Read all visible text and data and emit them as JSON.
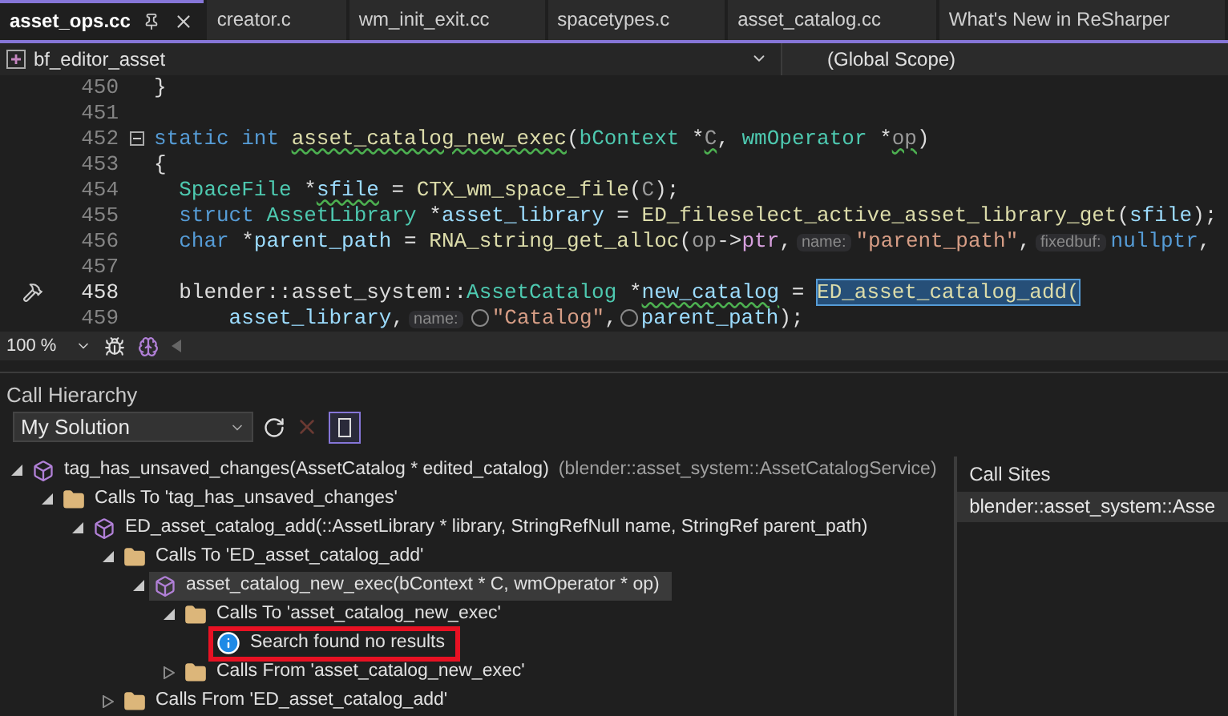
{
  "tabs": [
    {
      "label": "asset_ops.cc",
      "selected": true
    },
    {
      "label": "creator.c",
      "selected": false
    },
    {
      "label": "wm_init_exit.cc",
      "selected": false
    },
    {
      "label": "spacetypes.c",
      "selected": false
    },
    {
      "label": "asset_catalog.cc",
      "selected": false
    },
    {
      "label": "What's New in ReSharper",
      "selected": false
    }
  ],
  "navigation": {
    "project": "bf_editor_asset",
    "scope": "(Global Scope)"
  },
  "code_lines": [
    {
      "number": "450",
      "current": false,
      "collapsible": false,
      "marker": false,
      "tokens": [
        {
          "text": "}",
          "kind": "plain",
          "squiggle": false,
          "selected": false
        }
      ]
    },
    {
      "number": "451",
      "current": false,
      "collapsible": false,
      "marker": false
    },
    {
      "number": "452",
      "current": false,
      "collapsible": true,
      "marker": false,
      "tokens": [
        {
          "text": "static",
          "kind": "kw",
          "squiggle": false,
          "selected": false
        },
        {
          "text": " int ",
          "kind": "kw",
          "squiggle": false,
          "selected": false
        },
        {
          "text": "asset_catalog_new_exec",
          "kind": "fn",
          "squiggle": true,
          "selected": false
        },
        {
          "text": "(",
          "kind": "plain",
          "squiggle": false,
          "selected": false
        },
        {
          "text": "bContext",
          "kind": "type",
          "squiggle": false,
          "selected": false
        },
        {
          "text": " *",
          "kind": "plain",
          "squiggle": false,
          "selected": false
        },
        {
          "text": "C",
          "kind": "param",
          "squiggle": true,
          "selected": false
        },
        {
          "text": ",",
          "kind": "plain",
          "squiggle": false,
          "selected": false
        },
        {
          "text": " wmOperator",
          "kind": "type",
          "squiggle": false,
          "selected": false
        },
        {
          "text": " *",
          "kind": "plain",
          "squiggle": false,
          "selected": false
        },
        {
          "text": "op",
          "kind": "param",
          "squiggle": true,
          "selected": false
        },
        {
          "text": ")",
          "kind": "plain",
          "squiggle": false,
          "selected": false
        }
      ]
    },
    {
      "number": "453",
      "current": false,
      "collapsible": false,
      "marker": false,
      "tokens": [
        {
          "text": "{",
          "kind": "plain",
          "squiggle": false,
          "selected": false
        }
      ]
    },
    {
      "number": "454",
      "current": false,
      "collapsible": false,
      "marker": false,
      "tokens": [
        {
          "text": "  SpaceFile",
          "kind": "type",
          "squiggle": false,
          "selected": false
        },
        {
          "text": " *",
          "kind": "plain",
          "squiggle": false,
          "selected": false
        },
        {
          "text": "sfile",
          "kind": "var",
          "squiggle": true,
          "selected": false
        },
        {
          "text": " = ",
          "kind": "plain",
          "squiggle": false,
          "selected": false
        },
        {
          "text": "CTX_wm_space_file",
          "kind": "fn",
          "squiggle": false,
          "selected": false
        },
        {
          "text": "(",
          "kind": "plain",
          "squiggle": false,
          "selected": false
        },
        {
          "text": "C",
          "kind": "param",
          "squiggle": false,
          "selected": false
        },
        {
          "text": ");",
          "kind": "plain",
          "squiggle": false,
          "selected": false
        }
      ]
    },
    {
      "number": "455",
      "current": false,
      "collapsible": false,
      "marker": false,
      "tokens": [
        {
          "text": "  struct",
          "kind": "kw",
          "squiggle": false,
          "selected": false
        },
        {
          "text": " AssetLibrary",
          "kind": "type",
          "squiggle": false,
          "selected": false
        },
        {
          "text": " *",
          "kind": "plain",
          "squiggle": false,
          "selected": false
        },
        {
          "text": "asset_library",
          "kind": "var",
          "squiggle": false,
          "selected": false
        },
        {
          "text": " = ",
          "kind": "plain",
          "squiggle": false,
          "selected": false
        },
        {
          "text": "ED_fileselect_active_asset_library_get",
          "kind": "fn",
          "squiggle": false,
          "selected": false
        },
        {
          "text": "(",
          "kind": "plain",
          "squiggle": false,
          "selected": false
        },
        {
          "text": "sfile",
          "kind": "var",
          "squiggle": false,
          "selected": false
        },
        {
          "text": ");",
          "kind": "plain",
          "squiggle": false,
          "selected": false
        }
      ]
    },
    {
      "number": "456",
      "current": false,
      "collapsible": false,
      "marker": false,
      "tokens": [
        {
          "text": "  char",
          "kind": "kw",
          "squiggle": false,
          "selected": false
        },
        {
          "text": " *",
          "kind": "plain",
          "squiggle": false,
          "selected": false
        },
        {
          "text": "parent_path",
          "kind": "var",
          "squiggle": false,
          "selected": false
        },
        {
          "text": " = ",
          "kind": "plain",
          "squiggle": false,
          "selected": false
        },
        {
          "text": "RNA_string_get_alloc",
          "kind": "fn",
          "squiggle": false,
          "selected": false
        },
        {
          "text": "(",
          "kind": "plain",
          "squiggle": false,
          "selected": false
        },
        {
          "text": "op",
          "kind": "param",
          "squiggle": false,
          "selected": false
        },
        {
          "text": "->",
          "kind": "plain",
          "squiggle": false,
          "selected": false
        },
        {
          "text": "ptr",
          "kind": "member",
          "squiggle": false,
          "selected": false
        },
        {
          "text": ",",
          "kind": "plain",
          "squiggle": false,
          "selected": false
        },
        {
          "text": "name:",
          "kind": "hint",
          "squiggle": false,
          "selected": false
        },
        {
          "text": "\"parent_path\"",
          "kind": "str",
          "squiggle": false,
          "selected": false
        },
        {
          "text": ",",
          "kind": "plain",
          "squiggle": false,
          "selected": false
        },
        {
          "text": "fixedbuf:",
          "kind": "hint",
          "squiggle": false,
          "selected": false
        },
        {
          "text": "nullptr",
          "kind": "kw",
          "squiggle": false,
          "selected": false
        },
        {
          "text": ",",
          "kind": "plain",
          "squiggle": false,
          "selected": false
        }
      ]
    },
    {
      "number": "457",
      "current": false,
      "collapsible": false,
      "marker": false
    },
    {
      "number": "458",
      "current": true,
      "collapsible": false,
      "marker": true,
      "tokens": [
        {
          "text": "  blender::asset_system::",
          "kind": "plain",
          "squiggle": false,
          "selected": false
        },
        {
          "text": "AssetCatalog",
          "kind": "type",
          "squiggle": false,
          "selected": false
        },
        {
          "text": " *",
          "kind": "plain",
          "squiggle": false,
          "selected": false
        },
        {
          "text": "new_catalog",
          "kind": "var",
          "squiggle": true,
          "selected": false
        },
        {
          "text": " = ",
          "kind": "plain",
          "squiggle": false,
          "selected": false
        },
        {
          "text": "ED_asset_catalog_add(",
          "kind": "fn",
          "squiggle": false,
          "selected": true
        }
      ]
    },
    {
      "number": "459",
      "current": false,
      "collapsible": false,
      "marker": false,
      "tokens": [
        {
          "text": "      asset_library",
          "kind": "var",
          "squiggle": false,
          "selected": false
        },
        {
          "text": ",",
          "kind": "plain",
          "squiggle": false,
          "selected": false
        },
        {
          "text": "name:",
          "kind": "hint",
          "squiggle": false,
          "selected": false
        },
        {
          "kind": "inlay-icon",
          "squiggle": false,
          "selected": false
        },
        {
          "text": "\"Catalog\"",
          "kind": "str",
          "squiggle": false,
          "selected": false
        },
        {
          "text": ",",
          "kind": "plain",
          "squiggle": false,
          "selected": false
        },
        {
          "kind": "inlay-icon",
          "squiggle": false,
          "selected": false
        },
        {
          "text": "parent_path",
          "kind": "var",
          "squiggle": false,
          "selected": false
        },
        {
          "text": ");",
          "kind": "plain",
          "squiggle": false,
          "selected": false
        }
      ]
    }
  ],
  "zoom": "100 %",
  "call_hierarchy": {
    "title": "Call Hierarchy",
    "scope": "My Solution",
    "refresh_disabled": false,
    "cancel_disabled": true,
    "details_pane_on": true,
    "tree": [
      {
        "kind": "method",
        "label": "tag_has_unsaved_changes(AssetCatalog * edited_catalog)",
        "scope": "(blender::asset_system::AssetCatalogService)",
        "expanded": true,
        "selected": false,
        "highlighted": false,
        "children": [
          {
            "kind": "folder",
            "label": "Calls To 'tag_has_unsaved_changes'",
            "expanded": true,
            "selected": false,
            "highlighted": false,
            "children": [
              {
                "kind": "method",
                "label": "ED_asset_catalog_add(::AssetLibrary * library, StringRefNull name, StringRef parent_path)",
                "expanded": true,
                "selected": false,
                "highlighted": false,
                "children": [
                  {
                    "kind": "folder",
                    "label": "Calls To 'ED_asset_catalog_add'",
                    "expanded": true,
                    "selected": false,
                    "highlighted": false,
                    "children": [
                      {
                        "kind": "method",
                        "label": "asset_catalog_new_exec(bContext * C, wmOperator * op)",
                        "expanded": true,
                        "selected": true,
                        "highlighted": false,
                        "children": [
                          {
                            "kind": "folder",
                            "label": "Calls To 'asset_catalog_new_exec'",
                            "expanded": true,
                            "selected": false,
                            "highlighted": false,
                            "children": [
                              {
                                "kind": "info",
                                "label": "Search found no results",
                                "selected": false,
                                "highlighted": true
                              }
                            ]
                          },
                          {
                            "kind": "folder",
                            "label": "Calls From 'asset_catalog_new_exec'",
                            "expanded": false,
                            "selected": false,
                            "highlighted": false
                          }
                        ]
                      }
                    ]
                  },
                  {
                    "kind": "folder",
                    "label": "Calls From 'ED_asset_catalog_add'",
                    "expanded": false,
                    "selected": false,
                    "highlighted": false
                  }
                ]
              }
            ]
          }
        ]
      }
    ],
    "call_sites": {
      "title": "Call Sites",
      "rows": [
        {
          "text": "blender::asset_system::Asse",
          "selected": true
        }
      ]
    }
  }
}
